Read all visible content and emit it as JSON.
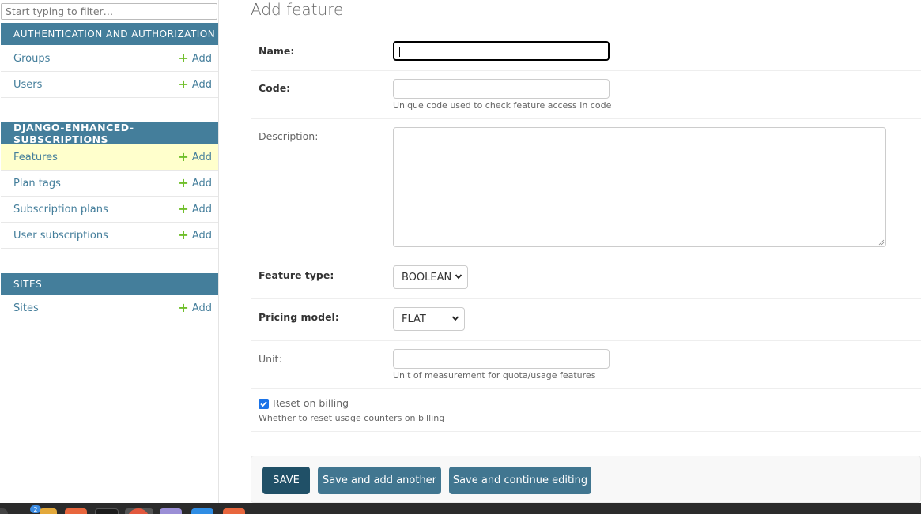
{
  "sidebar": {
    "filter_placeholder": "Start typing to filter…",
    "add_label": "Add",
    "modules": [
      {
        "caption": "Authentication and Authorization",
        "models": [
          {
            "label": "Groups"
          },
          {
            "label": "Users"
          }
        ]
      },
      {
        "caption": "DJANGO-ENHANCED-SUBSCRIPTIONS",
        "models": [
          {
            "label": "Features"
          },
          {
            "label": "Plan tags"
          },
          {
            "label": "Subscription plans"
          },
          {
            "label": "User subscriptions"
          }
        ]
      },
      {
        "caption": "Sites",
        "models": [
          {
            "label": "Sites"
          }
        ]
      }
    ]
  },
  "main": {
    "title": "Add feature",
    "fields": {
      "name": {
        "label": "Name:",
        "value": ""
      },
      "code": {
        "label": "Code:",
        "value": "",
        "help": "Unique code used to check feature access in code"
      },
      "description": {
        "label": "Description:",
        "value": ""
      },
      "feature_type": {
        "label": "Feature type:",
        "selected": "BOOLEAN"
      },
      "pricing_model": {
        "label": "Pricing model:",
        "selected": "FLAT"
      },
      "unit": {
        "label": "Unit:",
        "value": "",
        "help": "Unit of measurement for quota/usage features"
      },
      "reset_on_billing": {
        "label": "Reset on billing",
        "checked": true,
        "help": "Whether to reset usage counters on billing"
      }
    },
    "buttons": {
      "save": "SAVE",
      "save_add_another": "Save and add another",
      "save_continue": "Save and continue editing"
    }
  },
  "taskbar": {
    "badge_count": "2"
  },
  "colors": {
    "module_header": "#447e9b",
    "link": "#447e9b",
    "add_plus": "#70bf2b",
    "current_row": "#ffffcc",
    "save_button": "#205067",
    "secondary_button": "#417690"
  }
}
